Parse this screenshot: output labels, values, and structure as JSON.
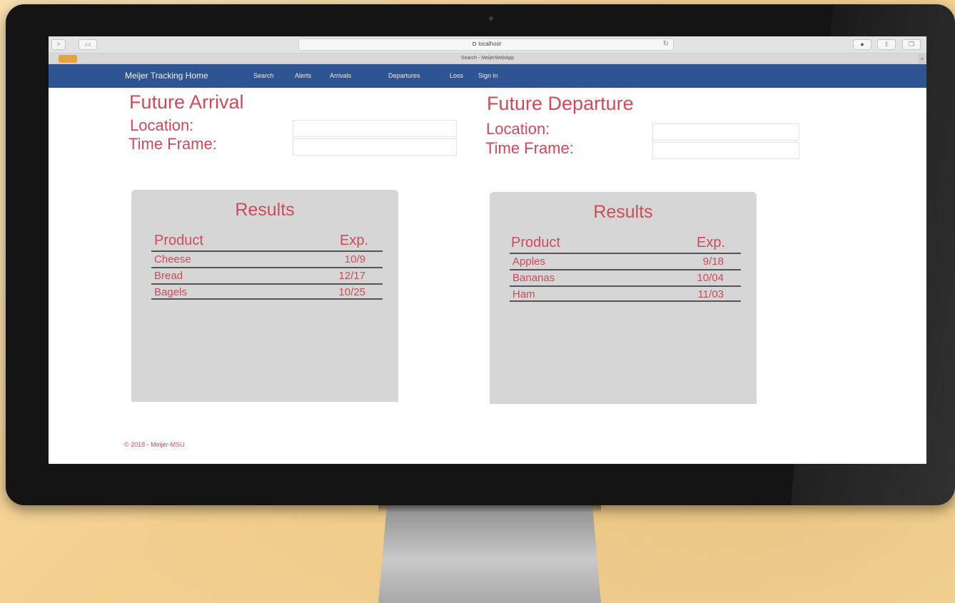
{
  "browser": {
    "address": "localhost",
    "tab_title": "Search - MeijerWebApp"
  },
  "nav": {
    "brand": "Meijer Tracking Home",
    "items": [
      "Search",
      "Alerts",
      "Arrivals",
      "Departures",
      "Loss",
      "Sign in"
    ]
  },
  "arrival": {
    "heading": "Future Arrival",
    "location_label": "Location:",
    "timeframe_label": "Time Frame:",
    "location_value": "",
    "timeframe_value": "",
    "results": {
      "title": "Results",
      "col_product": "Product",
      "col_exp": "Exp.",
      "rows": [
        {
          "product": "Cheese",
          "exp": "10/9"
        },
        {
          "product": "Bread",
          "exp": "12/17"
        },
        {
          "product": "Bagels",
          "exp": "10/25"
        }
      ]
    }
  },
  "departure": {
    "heading": "Future Departure",
    "location_label": "Location:",
    "timeframe_label": "Time Frame:",
    "location_value": "",
    "timeframe_value": "",
    "results": {
      "title": "Results",
      "col_product": "Product",
      "col_exp": "Exp.",
      "rows": [
        {
          "product": "Apples",
          "exp": "9/18"
        },
        {
          "product": "Bananas",
          "exp": "10/04"
        },
        {
          "product": "Ham",
          "exp": "11/03"
        }
      ]
    }
  },
  "footer": {
    "text": "© 2018 - Meijer-MSU"
  },
  "colors": {
    "navbar": "#2e5592",
    "accent_text": "#d04a5a",
    "panel": "#d6d6d6"
  }
}
